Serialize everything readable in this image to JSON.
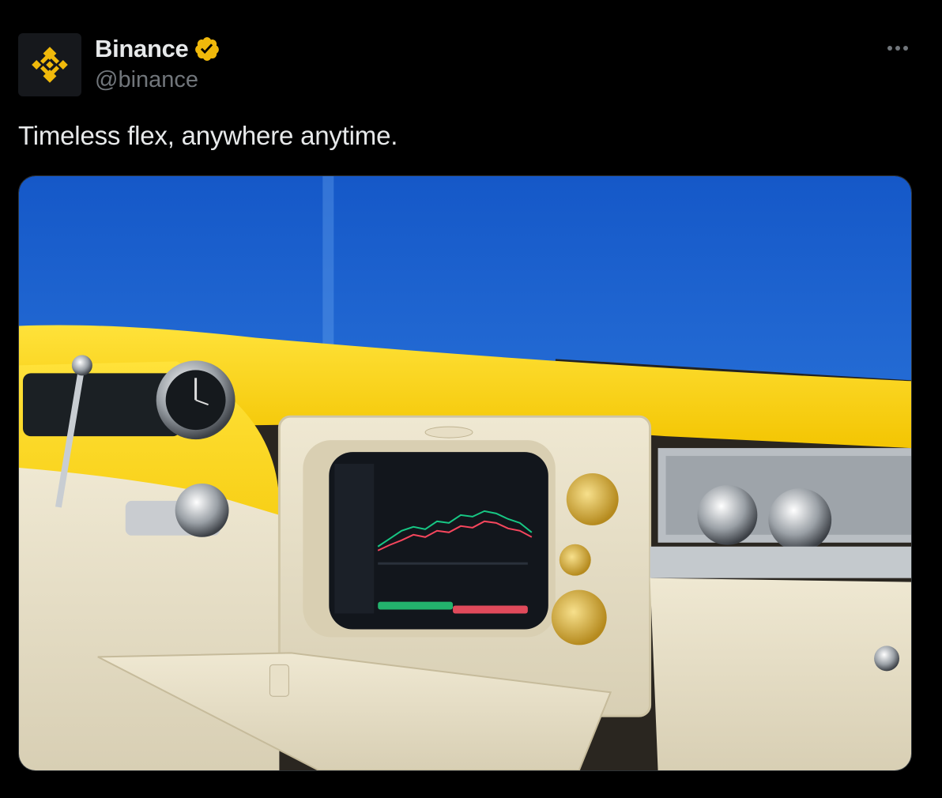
{
  "author": {
    "display_name": "Binance",
    "handle": "@binance",
    "verified": true,
    "avatar_icon": "binance-logo-icon",
    "brand_color": "#F0B90B"
  },
  "tweet": {
    "text": "Timeless flex, anywhere anytime."
  },
  "menu": {
    "icon": "more-horizontal-icon"
  },
  "media": {
    "type": "photo",
    "subject": "retro-car-dashboard-trading-screen",
    "accent_color": "#FFD400",
    "sky_color": "#1E6FD9"
  }
}
